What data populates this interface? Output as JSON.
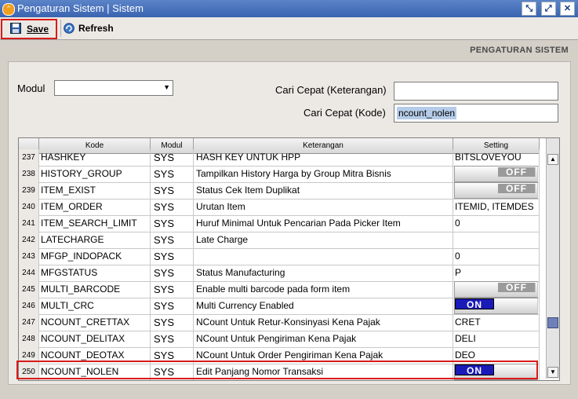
{
  "window": {
    "title": "Pengaturan Sistem | Sistem"
  },
  "toolbar": {
    "save_label": "Save",
    "refresh_label": "Refresh"
  },
  "panel_title": "PENGATURAN SISTEM",
  "filters": {
    "modul_label": "Modul",
    "modul_value": "",
    "cari_keterangan_label": "Cari Cepat (Keterangan)",
    "cari_keterangan_value": "",
    "cari_kode_label": "Cari Cepat (Kode)",
    "cari_kode_value": "ncount_nolen"
  },
  "grid": {
    "headers": {
      "kode": "Kode",
      "modul": "Modul",
      "keterangan": "Keterangan",
      "setting": "Setting"
    },
    "rows": [
      {
        "no": "237",
        "kode": "HASHKEY",
        "modul": "SYS",
        "keterangan": "HASH KEY UNTUK HPP",
        "setting": "BITSLOVEYOU"
      },
      {
        "no": "238",
        "kode": "HISTORY_GROUP",
        "modul": "SYS",
        "keterangan": "Tampilkan History Harga by Group Mitra Bisnis",
        "toggle": "OFF"
      },
      {
        "no": "239",
        "kode": "ITEM_EXIST",
        "modul": "SYS",
        "keterangan": "Status Cek Item Duplikat",
        "toggle": "OFF"
      },
      {
        "no": "240",
        "kode": "ITEM_ORDER",
        "modul": "SYS",
        "keterangan": "Urutan Item",
        "setting": "ITEMID, ITEMDES"
      },
      {
        "no": "241",
        "kode": "ITEM_SEARCH_LIMIT",
        "modul": "SYS",
        "keterangan": "Huruf Minimal Untuk Pencarian Pada Picker Item",
        "setting": "0"
      },
      {
        "no": "242",
        "kode": "LATECHARGE",
        "modul": "SYS",
        "keterangan": "Late Charge",
        "setting": ""
      },
      {
        "no": "243",
        "kode": "MFGP_INDOPACK",
        "modul": "SYS",
        "keterangan": "",
        "setting": "0"
      },
      {
        "no": "244",
        "kode": "MFGSTATUS",
        "modul": "SYS",
        "keterangan": "Status Manufacturing",
        "setting": "P"
      },
      {
        "no": "245",
        "kode": "MULTI_BARCODE",
        "modul": "SYS",
        "keterangan": "Enable multi barcode pada form item",
        "toggle": "OFF"
      },
      {
        "no": "246",
        "kode": "MULTI_CRC",
        "modul": "SYS",
        "keterangan": "Multi Currency Enabled",
        "toggle": "ON"
      },
      {
        "no": "247",
        "kode": "NCOUNT_CRETTAX",
        "modul": "SYS",
        "keterangan": "NCount Untuk Retur-Konsinyasi Kena Pajak",
        "setting": "CRET"
      },
      {
        "no": "248",
        "kode": "NCOUNT_DELITAX",
        "modul": "SYS",
        "keterangan": "NCount Untuk Pengiriman Kena Pajak",
        "setting": "DELI"
      },
      {
        "no": "249",
        "kode": "NCOUNT_DEOTAX",
        "modul": "SYS",
        "keterangan": "NCount Untuk Order Pengiriman Kena Pajak",
        "setting": "DEO"
      },
      {
        "no": "250",
        "kode": "NCOUNT_NOLEN",
        "modul": "SYS",
        "keterangan": "Edit Panjang Nomor Transaksi",
        "toggle": "ON"
      }
    ]
  },
  "colors": {
    "highlight_border": "#d81b1b",
    "toggle_on": "#1a1ab8",
    "toggle_off": "#9a9a9a"
  },
  "icons": {
    "window": "app-icon",
    "save": "floppy-disk-icon",
    "refresh": "refresh-icon"
  }
}
